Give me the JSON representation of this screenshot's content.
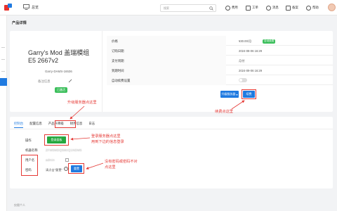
{
  "topbar": {
    "home_label": "总览",
    "search_placeholder": "搜索",
    "nav": [
      "费用",
      "工单",
      "消息",
      "备案",
      "帮助"
    ],
    "nav_icons": [
      "coin-icon",
      "ticket-icon",
      "bell-icon",
      "record-icon",
      "help-icon"
    ]
  },
  "page": {
    "title": "产品详情"
  },
  "product": {
    "name": "Garry's Mod 盖瑞模组 E5 2667v2",
    "code": "Garry-DAMS-16536",
    "remark_label": "备注信息",
    "status": "已激活"
  },
  "info_table": [
    {
      "label": "价格",
      "value": "¥30.00/月",
      "badge": "自动续费"
    },
    {
      "label": "订购日期",
      "value": "2024-08-06 16:29"
    },
    {
      "label": "支付周期",
      "value": "月付"
    },
    {
      "label": "到期时间",
      "value": "2024-09-06 16:29"
    },
    {
      "label": "自动续费设置",
      "value": "",
      "toggle": false
    }
  ],
  "actions": {
    "upgrade_label": "升级服务器",
    "renew_label": "续费"
  },
  "tabs": [
    {
      "label": "控制台",
      "active": true
    },
    {
      "label": "配置信息",
      "active": false
    },
    {
      "label": "产品升降级",
      "active": false
    },
    {
      "label": "财务信息",
      "active": false
    },
    {
      "label": "日志",
      "active": false
    }
  ],
  "console": {
    "operate_label": "操作",
    "login_button": "登录面板",
    "machine_label": "机器名称",
    "machine_value": "ZFM5MDQ5MzQ1NDM5",
    "user_label": "用户名",
    "user_value": "admin",
    "password_label": "密码",
    "password_value": "请点击\"重置\"",
    "reset_button": "重置"
  },
  "annotations": {
    "upgrade_here": "升级服务器点这里",
    "renew_here": "续费点这里",
    "login_here_1": "登录服务器点这里",
    "login_here_2": "用到下边的信息登录",
    "no_password_1": "没有密码或密码不对",
    "no_password_2": "点这里"
  },
  "footer": "仅限个人",
  "colors": {
    "accent": "#1f7ae0",
    "success": "#25a83f",
    "annotation": "#e53935"
  }
}
